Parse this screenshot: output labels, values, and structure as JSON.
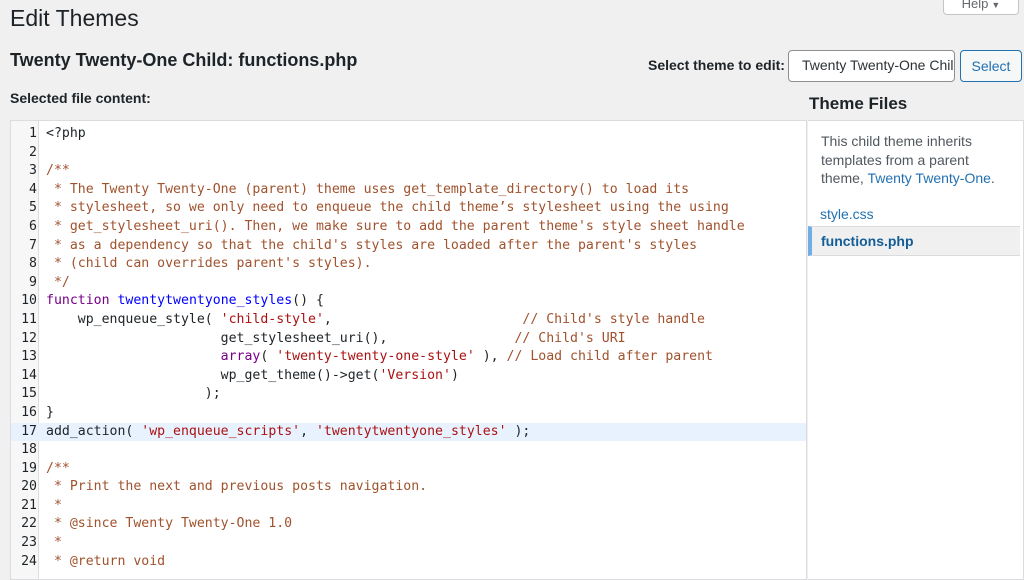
{
  "page": {
    "title": "Edit Themes",
    "help_label": "Help",
    "file_heading": "Twenty Twenty-One Child: functions.php",
    "select_theme_label": "Select theme to edit:",
    "selected_theme": "Twenty Twenty-One Child",
    "select_button": "Select",
    "content_label": "Selected file content:"
  },
  "theme_files": {
    "title": "Theme Files",
    "note_prefix": "This child theme inherits templates from a parent theme, ",
    "parent_link": "Twenty Twenty-One",
    "note_suffix": ".",
    "files": [
      {
        "name": "style.css",
        "active": false
      },
      {
        "name": "functions.php",
        "active": true
      }
    ]
  },
  "editor": {
    "active_line": 17,
    "lines": [
      {
        "n": "1",
        "parts": [
          {
            "t": "<?php",
            "k": ""
          }
        ]
      },
      {
        "n": "2",
        "parts": []
      },
      {
        "n": "3",
        "parts": [
          {
            "t": "/**",
            "k": "cm"
          }
        ]
      },
      {
        "n": "4",
        "parts": [
          {
            "t": " * The Twenty Twenty-One (parent) theme uses get_template_directory() to load its",
            "k": "cm"
          }
        ]
      },
      {
        "n": "5",
        "parts": [
          {
            "t": " * stylesheet, so we only need to enqueue the child theme’s stylesheet using the using",
            "k": "cm"
          }
        ]
      },
      {
        "n": "6",
        "parts": [
          {
            "t": " * get_stylesheet_uri(). Then, we make sure to add the parent theme's style sheet handle",
            "k": "cm"
          }
        ]
      },
      {
        "n": "7",
        "parts": [
          {
            "t": " * as a dependency so that the child's styles are loaded after the parent's styles",
            "k": "cm"
          }
        ]
      },
      {
        "n": "8",
        "parts": [
          {
            "t": " * (child can overrides parent's styles).",
            "k": "cm"
          }
        ]
      },
      {
        "n": "9",
        "parts": [
          {
            "t": " */",
            "k": "cm"
          }
        ]
      },
      {
        "n": "10",
        "parts": [
          {
            "t": "function",
            "k": "kw"
          },
          {
            "t": " ",
            "k": ""
          },
          {
            "t": "twentytwentyone_styles",
            "k": "fn"
          },
          {
            "t": "() {",
            "k": ""
          }
        ]
      },
      {
        "n": "11",
        "parts": [
          {
            "t": "    wp_enqueue_style( ",
            "k": ""
          },
          {
            "t": "'child-style'",
            "k": "st"
          },
          {
            "t": ",                        ",
            "k": ""
          },
          {
            "t": "// Child's style handle",
            "k": "cm"
          }
        ]
      },
      {
        "n": "12",
        "parts": [
          {
            "t": "                      get_stylesheet_uri(),                ",
            "k": ""
          },
          {
            "t": "// Child's URI",
            "k": "cm"
          }
        ]
      },
      {
        "n": "13",
        "parts": [
          {
            "t": "                      ",
            "k": ""
          },
          {
            "t": "array",
            "k": "kw"
          },
          {
            "t": "( ",
            "k": ""
          },
          {
            "t": "'twenty-twenty-one-style'",
            "k": "st"
          },
          {
            "t": " ), ",
            "k": ""
          },
          {
            "t": "// Load child after parent",
            "k": "cm"
          }
        ]
      },
      {
        "n": "14",
        "parts": [
          {
            "t": "                      wp_get_theme()->get(",
            "k": ""
          },
          {
            "t": "'Version'",
            "k": "st"
          },
          {
            "t": ")",
            "k": ""
          }
        ]
      },
      {
        "n": "15",
        "parts": [
          {
            "t": "                    );",
            "k": ""
          }
        ]
      },
      {
        "n": "16",
        "parts": [
          {
            "t": "}",
            "k": ""
          }
        ]
      },
      {
        "n": "17",
        "parts": [
          {
            "t": "add_action( ",
            "k": ""
          },
          {
            "t": "'wp_enqueue_scripts'",
            "k": "st"
          },
          {
            "t": ", ",
            "k": ""
          },
          {
            "t": "'twentytwentyone_styles'",
            "k": "st"
          },
          {
            "t": " );",
            "k": ""
          }
        ]
      },
      {
        "n": "18",
        "parts": []
      },
      {
        "n": "19",
        "parts": [
          {
            "t": "/**",
            "k": "cm"
          }
        ]
      },
      {
        "n": "20",
        "parts": [
          {
            "t": " * Print the next and previous posts navigation.",
            "k": "cm"
          }
        ]
      },
      {
        "n": "21",
        "parts": [
          {
            "t": " *",
            "k": "cm"
          }
        ]
      },
      {
        "n": "22",
        "parts": [
          {
            "t": " * @since Twenty Twenty-One 1.0",
            "k": "cm"
          }
        ]
      },
      {
        "n": "23",
        "parts": [
          {
            "t": " *",
            "k": "cm"
          }
        ]
      },
      {
        "n": "24",
        "parts": [
          {
            "t": " * @return void",
            "k": "cm"
          }
        ]
      }
    ]
  },
  "colors": {
    "link": "#2271b1",
    "comment": "#a0522d",
    "keyword": "#770088",
    "function": "#0000ff",
    "string": "#aa1111",
    "active_line_bg": "#e8f2ff"
  }
}
